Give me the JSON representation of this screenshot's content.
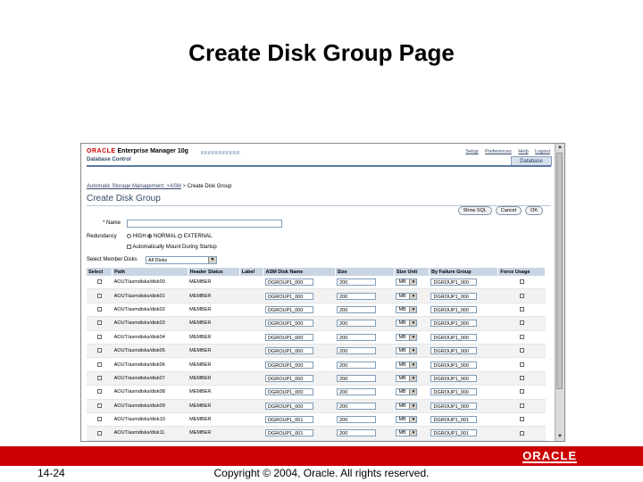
{
  "slide": {
    "title": "Create Disk Group Page",
    "number": "14-24",
    "copyright": "Copyright © 2004, Oracle.  All rights reserved.",
    "footer_logo": "ORACLE"
  },
  "em": {
    "logo_oracle": "ORACLE",
    "logo_product": "Enterprise Manager 10g",
    "subtitle": "Database Control",
    "global_links": [
      "Setup",
      "Preferences",
      "Help",
      "Logout"
    ],
    "tab": "Database"
  },
  "breadcrumb": {
    "link": "Automatic Storage Management: +ASM",
    "separator": ">",
    "current": "Create Disk Group"
  },
  "page": {
    "heading": "Create Disk Group",
    "buttons": {
      "show_sql": "Show SQL",
      "cancel": "Cancel",
      "ok": "OK"
    }
  },
  "form": {
    "name_label": "* Name",
    "name_value": "",
    "redundancy_label": "Redundancy",
    "redundancy_options": [
      "HIGH",
      "NORMAL",
      "EXTERNAL"
    ],
    "redundancy_selected": "NORMAL",
    "auto_mount_label": "Automatically Mount During Startup",
    "member_disks_label": "Select Member Disks",
    "member_disks_value": "All Disks"
  },
  "table": {
    "headers": [
      "Select",
      "Path",
      "Header Status",
      "Label",
      "ASM Disk Name",
      "Size",
      "Size Unit",
      "By Failure Group",
      "Force Usage"
    ],
    "rows": [
      {
        "path": "AOUT/asmdisks/disk00",
        "status": "MEMBER",
        "disk_name": "DGROUP1_000",
        "size": "200",
        "unit": "MB",
        "fgroup": "DGROUP1_000"
      },
      {
        "path": "AOUT/asmdisks/disk01",
        "status": "MEMBER",
        "disk_name": "DGROUP1_000",
        "size": "200",
        "unit": "MB",
        "fgroup": "DGROUP1_000"
      },
      {
        "path": "AOUT/asmdisks/disk02",
        "status": "MEMBER",
        "disk_name": "DGROUP1_000",
        "size": "200",
        "unit": "MB",
        "fgroup": "DGROUP1_000"
      },
      {
        "path": "AOUT/asmdisks/disk03",
        "status": "MEMBER",
        "disk_name": "DGROUP1_000",
        "size": "200",
        "unit": "MB",
        "fgroup": "DGROUP1_000"
      },
      {
        "path": "AOUT/asmdisks/disk04",
        "status": "MEMBER",
        "disk_name": "DGROUP1_000",
        "size": "200",
        "unit": "MB",
        "fgroup": "DGROUP1_000"
      },
      {
        "path": "AOUT/asmdisks/disk05",
        "status": "MEMBER",
        "disk_name": "DGROUP1_000",
        "size": "200",
        "unit": "MB",
        "fgroup": "DGROUP1_000"
      },
      {
        "path": "AOUT/asmdisks/disk06",
        "status": "MEMBER",
        "disk_name": "DGROUP1_000",
        "size": "200",
        "unit": "MB",
        "fgroup": "DGROUP1_000"
      },
      {
        "path": "AOUT/asmdisks/disk07",
        "status": "MEMBER",
        "disk_name": "DGROUP1_000",
        "size": "200",
        "unit": "MB",
        "fgroup": "DGROUP1_000"
      },
      {
        "path": "AOUT/asmdisks/disk08",
        "status": "MEMBER",
        "disk_name": "DGROUP1_000",
        "size": "200",
        "unit": "MB",
        "fgroup": "DGROUP1_000"
      },
      {
        "path": "AOUT/asmdisks/disk09",
        "status": "MEMBER",
        "disk_name": "DGROUP1_000",
        "size": "200",
        "unit": "MB",
        "fgroup": "DGROUP1_000"
      },
      {
        "path": "AOUT/asmdisks/disk10",
        "status": "MEMBER",
        "disk_name": "DGROUP1_001",
        "size": "200",
        "unit": "MB",
        "fgroup": "DGROUP1_001"
      },
      {
        "path": "AOUT/asmdisks/disk11",
        "status": "MEMBER",
        "disk_name": "DGROUP1_001",
        "size": "200",
        "unit": "MB",
        "fgroup": "DGROUP1_001"
      },
      {
        "path": "AOUT/asmdisks/disk12",
        "status": "MEMBER",
        "disk_name": "DGROUP1_001",
        "size": "200",
        "unit": "MB",
        "fgroup": "DGROUP1_001"
      }
    ]
  },
  "colors": {
    "brand_red": "#cc0000",
    "em_blue": "#35476a",
    "table_header": "#c8d5e3"
  }
}
